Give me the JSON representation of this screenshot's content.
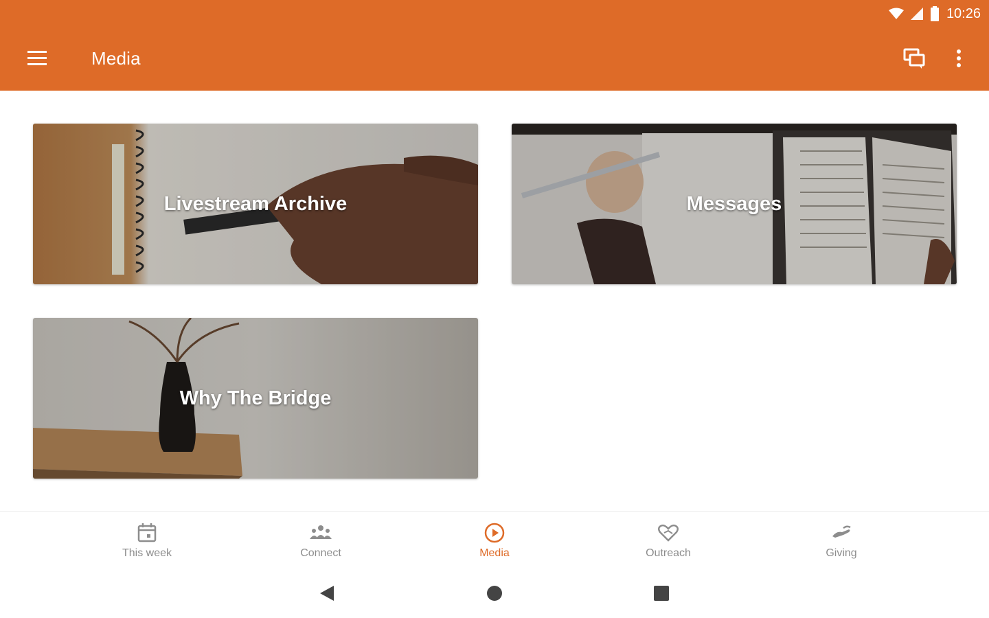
{
  "status_bar": {
    "time": "10:26",
    "icons": [
      "wifi-icon",
      "cell-signal-icon",
      "battery-icon"
    ]
  },
  "app_bar": {
    "title": "Media",
    "menu_icon": "hamburger-menu-icon",
    "actions": [
      "chat-icon",
      "more-vert-icon"
    ],
    "color": "#de6b28"
  },
  "cards": [
    {
      "label": "Livestream Archive"
    },
    {
      "label": "Messages"
    },
    {
      "label": "Why The Bridge"
    }
  ],
  "bottom_nav": {
    "items": [
      {
        "label": "This week",
        "icon": "calendar-icon"
      },
      {
        "label": "Connect",
        "icon": "group-icon"
      },
      {
        "label": "Media",
        "icon": "play-circle-icon",
        "active": true
      },
      {
        "label": "Outreach",
        "icon": "heart-hands-icon"
      },
      {
        "label": "Giving",
        "icon": "giving-hand-icon"
      }
    ],
    "active_color": "#de6b28",
    "inactive_color": "#8d8d8d"
  },
  "system_nav": [
    "back-icon",
    "home-icon",
    "recents-icon"
  ]
}
